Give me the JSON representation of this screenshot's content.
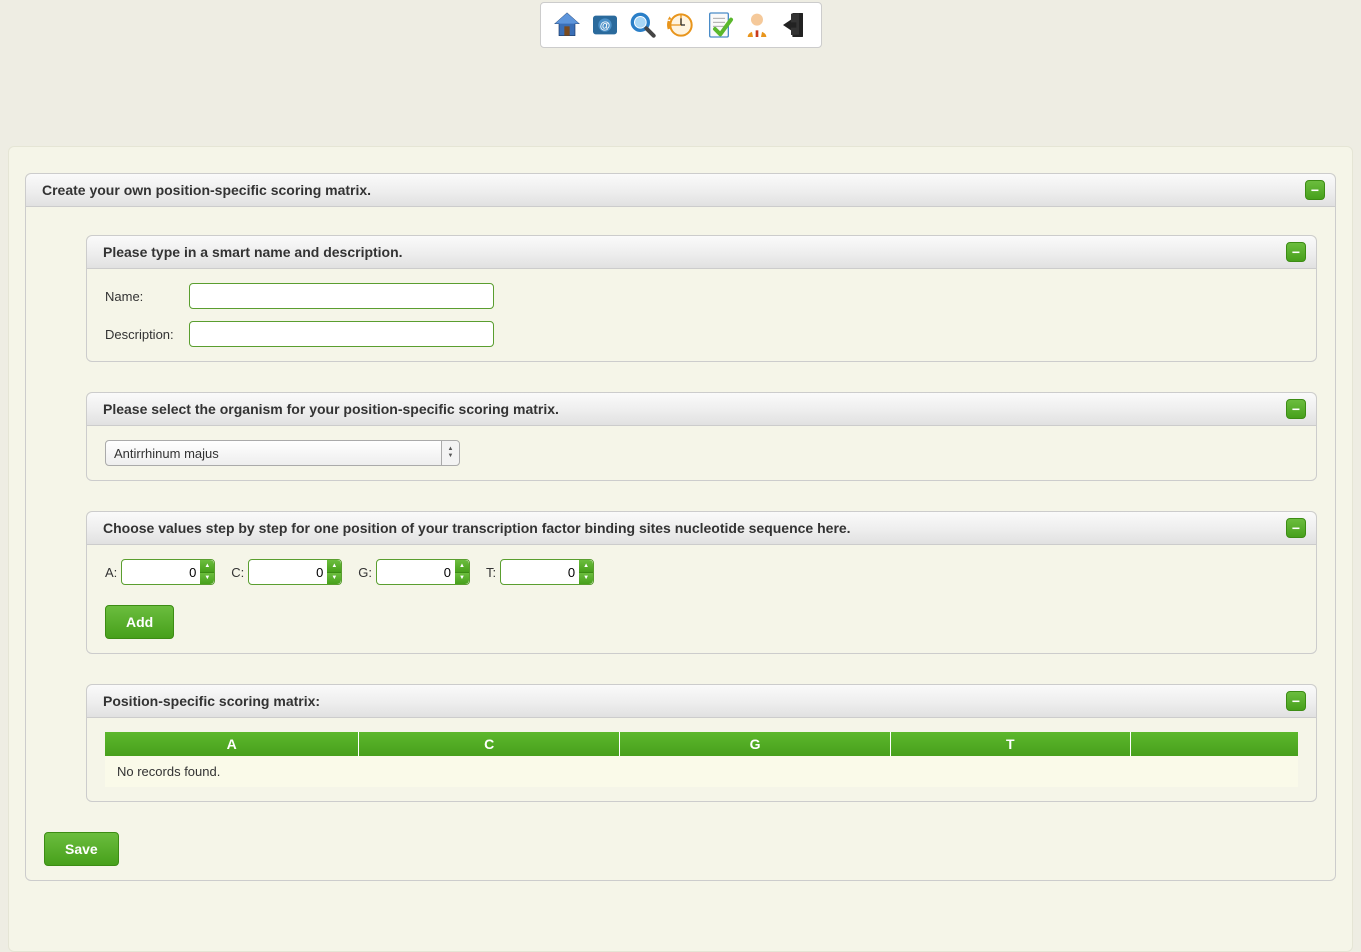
{
  "toolbar": {
    "icons": [
      "home-icon",
      "contact-icon",
      "search-icon",
      "history-icon",
      "tasks-icon",
      "user-icon",
      "logout-icon"
    ]
  },
  "main_panel_title": "Create your own position-specific scoring matrix.",
  "section_name": {
    "title": "Please type in a smart name and description.",
    "name_label": "Name:",
    "name_value": "",
    "desc_label": "Description:",
    "desc_value": ""
  },
  "section_organism": {
    "title": "Please select the organism for your position-specific scoring matrix.",
    "selected": "Antirrhinum majus"
  },
  "section_values": {
    "title": "Choose values step by step for one position of your transcription factor binding sites nucleotide sequence here.",
    "nucleotides": [
      {
        "label": "A:",
        "value": "0"
      },
      {
        "label": "C:",
        "value": "0"
      },
      {
        "label": "G:",
        "value": "0"
      },
      {
        "label": "T:",
        "value": "0"
      }
    ],
    "add_label": "Add"
  },
  "section_matrix": {
    "title": "Position-specific scoring matrix:",
    "columns": [
      "A",
      "C",
      "G",
      "T"
    ],
    "empty_message": "No records found."
  },
  "save_label": "Save"
}
